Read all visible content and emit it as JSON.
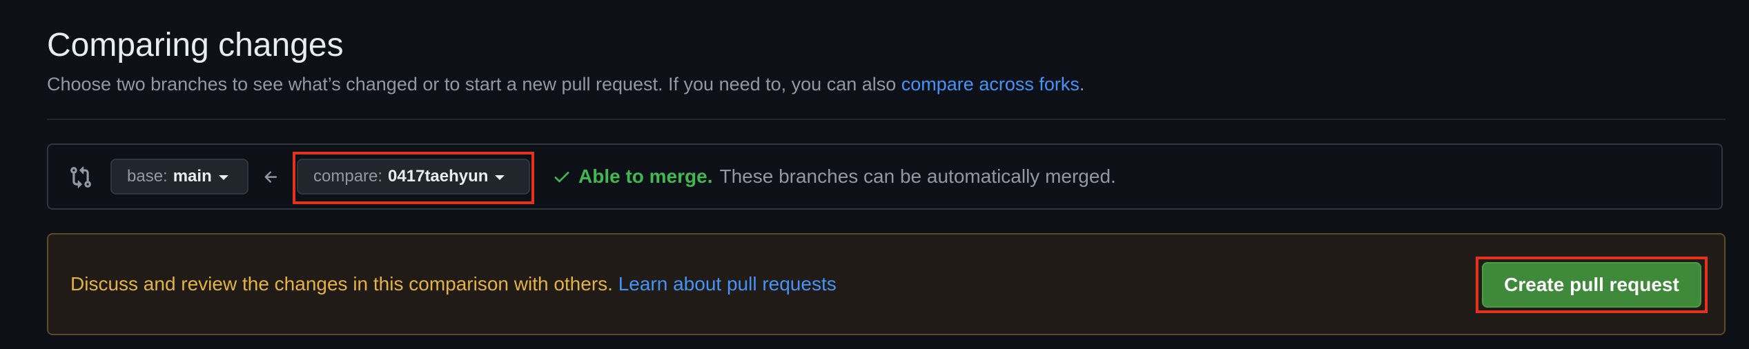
{
  "header": {
    "title": "Comparing changes",
    "subtitle_prefix": "Choose two branches to see what’s changed or to start a new pull request. If you need to, you can also ",
    "subtitle_link": "compare across forks",
    "subtitle_suffix": "."
  },
  "compare_bar": {
    "compare_icon": "git-compare-icon",
    "base": {
      "label": "base:",
      "branch": "main"
    },
    "arrow_icon": "arrow-left-icon",
    "compare": {
      "label": "compare:",
      "branch": "0417taehyun"
    },
    "merge_status": {
      "icon": "check-icon",
      "status": "Able to merge.",
      "description": "These branches can be automatically merged."
    }
  },
  "notice": {
    "text": "Discuss and review the changes in this comparison with others. ",
    "link": "Learn about pull requests",
    "button_label": "Create pull request"
  },
  "colors": {
    "background": "#0d1117",
    "link": "#4493f8",
    "success": "#3fb950",
    "warning_text": "#e3b341",
    "button_green": "#3f8a3a",
    "highlight": "#e5321d"
  }
}
